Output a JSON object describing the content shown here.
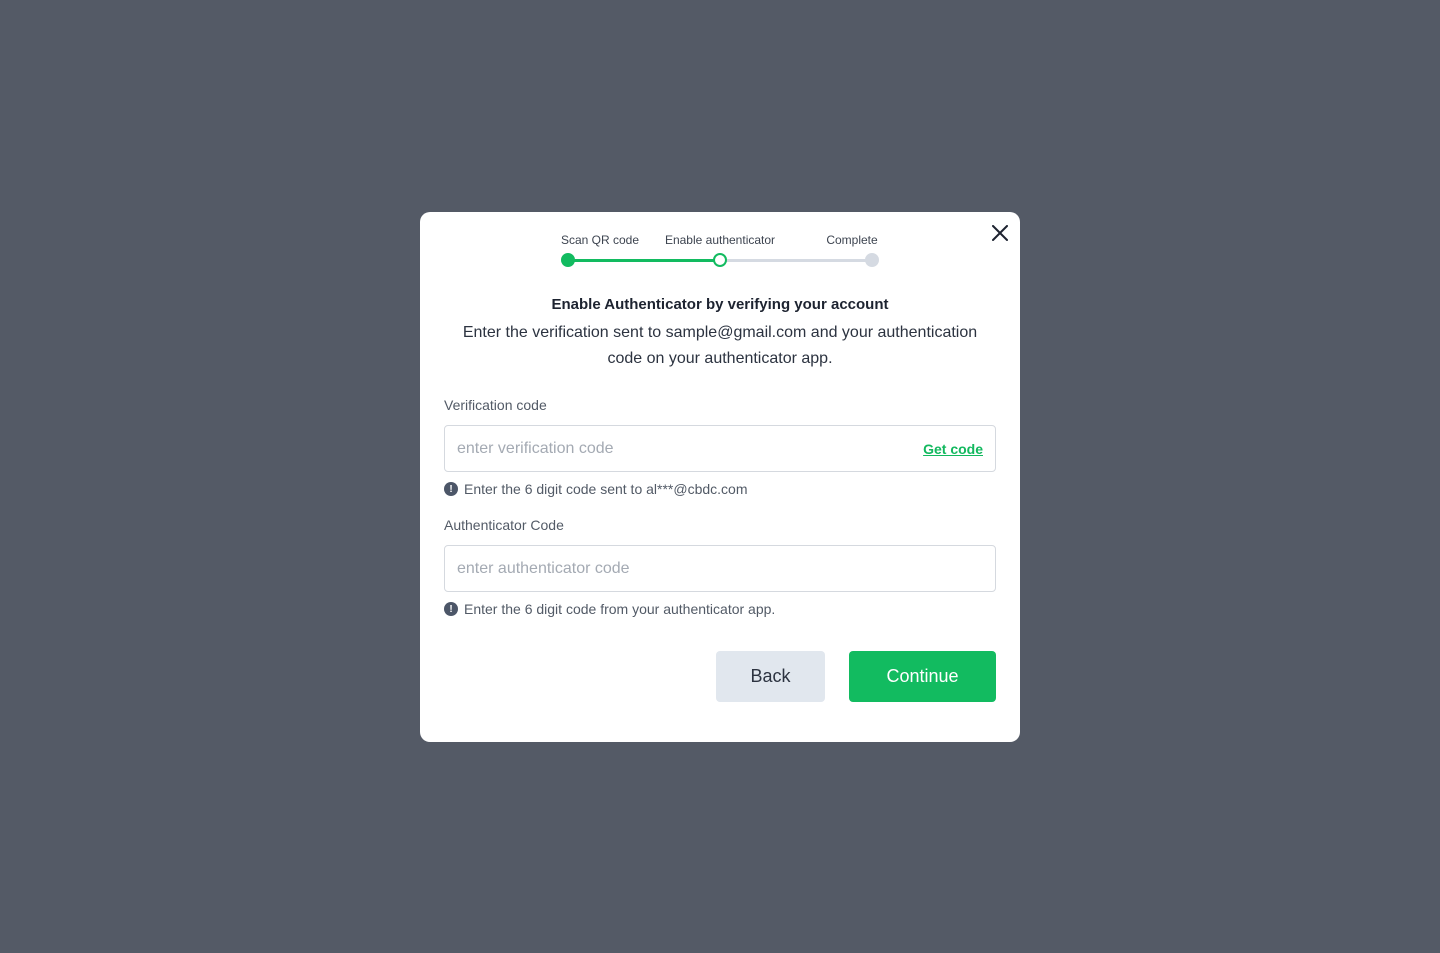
{
  "colors": {
    "overlay": "#545a66",
    "accent": "#12bb60",
    "step_inactive": "#d5dae2"
  },
  "stepper": {
    "steps": [
      {
        "label": "Scan QR code",
        "state": "done"
      },
      {
        "label": "Enable authenticator",
        "state": "current"
      },
      {
        "label": "Complete",
        "state": "pending"
      }
    ]
  },
  "modal": {
    "close_icon": "close-icon",
    "heading": "Enable Authenticator by verifying your account",
    "subtext": "Enter the verification sent to sample@gmail.com and your authentication code on your authenticator app."
  },
  "verification": {
    "label": "Verification code",
    "placeholder": "enter verification code",
    "value": "",
    "get_code_label": "Get code",
    "hint_icon": "exclamation-circle-icon",
    "hint": "Enter the 6 digit code sent to al***@cbdc.com"
  },
  "authenticator": {
    "label": "Authenticator Code",
    "placeholder": "enter authenticator code",
    "value": "",
    "hint_icon": "exclamation-circle-icon",
    "hint": "Enter the 6 digit code from your authenticator app."
  },
  "actions": {
    "back_label": "Back",
    "continue_label": "Continue"
  }
}
